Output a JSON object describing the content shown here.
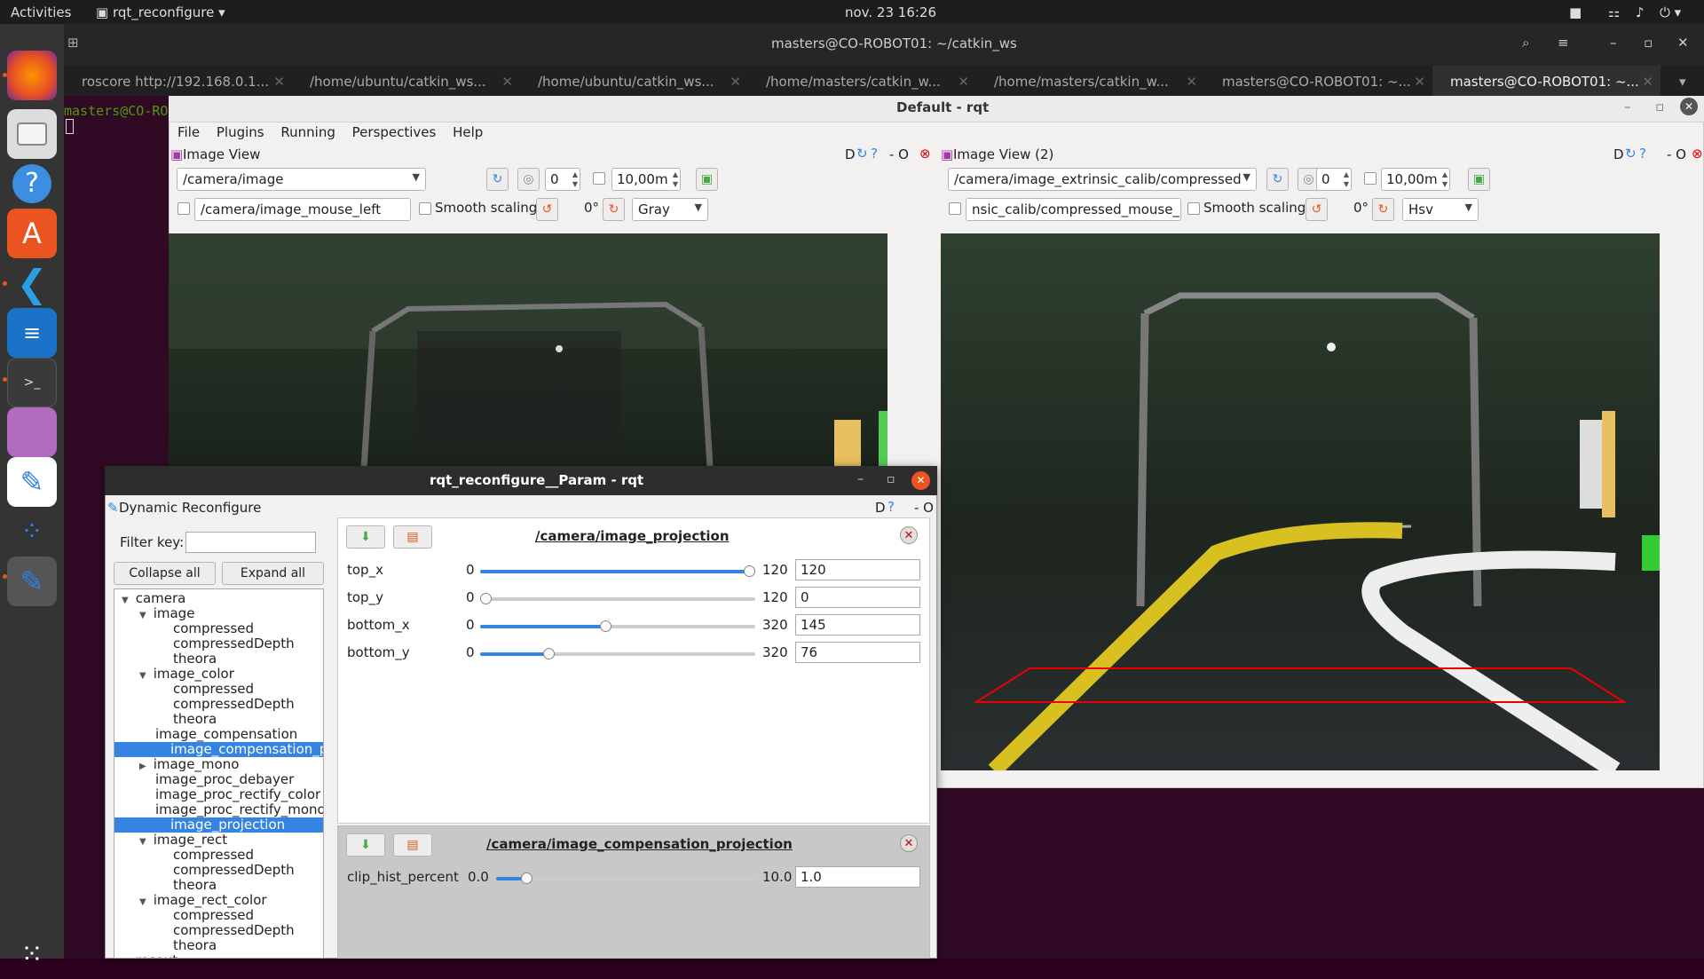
{
  "topbar": {
    "activities": "Activities",
    "app": "rqt_reconfigure",
    "datetime": "nov. 23  16:26"
  },
  "terminal": {
    "title": "masters@CO-ROBOT01: ~/catkin_ws",
    "prompt": "masters@CO-RO",
    "tabs": [
      "roscore http://192.168.0.1...",
      "/home/ubuntu/catkin_ws...",
      "/home/ubuntu/catkin_ws...",
      "/home/masters/catkin_w...",
      "/home/masters/catkin_w...",
      "masters@CO-ROBOT01: ~...",
      "masters@CO-ROBOT01: ~..."
    ]
  },
  "rqt": {
    "title": "Default - rqt",
    "menu": [
      "File",
      "Plugins",
      "Running",
      "Perspectives",
      "Help"
    ]
  },
  "iv1": {
    "title": "Image View",
    "topic": "/camera/image",
    "spin": "0",
    "rate": "10,00m",
    "mouse": "/camera/image_mouse_left",
    "smooth": "Smooth scaling",
    "rot": "0°",
    "color": "Gray",
    "tools": "D",
    "dash": "- O"
  },
  "iv2": {
    "title": "Image View (2)",
    "topic": "/camera/image_extrinsic_calib/compressed",
    "spin": "0",
    "rate": "10,00m",
    "mouse": "nsic_calib/compressed_mouse_left",
    "smooth": "Smooth scaling",
    "rot": "0°",
    "color": "Hsv",
    "tools": "D",
    "dash": "- O"
  },
  "rec": {
    "title": "rqt_reconfigure__Param - rqt",
    "plugin": "Dynamic Reconfigure",
    "filter": "Filter key:",
    "collapse": "Collapse all",
    "expand": "Expand all",
    "tools": "D",
    "dash": "- O",
    "tree": [
      {
        "t": "camera",
        "exp": "open"
      },
      {
        "t": "image",
        "exp": "open"
      },
      {
        "t": "compressed"
      },
      {
        "t": "compressedDepth"
      },
      {
        "t": "theora"
      },
      {
        "t": "image_color",
        "exp": "open"
      },
      {
        "t": "compressed"
      },
      {
        "t": "compressedDepth"
      },
      {
        "t": "theora"
      },
      {
        "t": "image_compensation"
      },
      {
        "t": "image_compensation_pro...",
        "sel": true
      },
      {
        "t": "image_mono",
        "exp": "closed"
      },
      {
        "t": "image_proc_debayer"
      },
      {
        "t": "image_proc_rectify_color"
      },
      {
        "t": "image_proc_rectify_mono"
      },
      {
        "t": "image_projection",
        "sel": true
      },
      {
        "t": "image_rect",
        "exp": "open"
      },
      {
        "t": "compressed"
      },
      {
        "t": "compressedDepth"
      },
      {
        "t": "theora"
      },
      {
        "t": "image_rect_color",
        "exp": "open"
      },
      {
        "t": "compressed"
      },
      {
        "t": "compressedDepth"
      },
      {
        "t": "theora"
      },
      {
        "t": "rosout",
        "exp": "closed"
      }
    ],
    "p1": {
      "title": "/camera/image_projection",
      "params": [
        {
          "name": "top_x",
          "min": "0",
          "max": "120",
          "val": "120"
        },
        {
          "name": "top_y",
          "min": "0",
          "max": "120",
          "val": "0"
        },
        {
          "name": "bottom_x",
          "min": "0",
          "max": "320",
          "val": "145"
        },
        {
          "name": "bottom_y",
          "min": "0",
          "max": "320",
          "val": "76"
        }
      ]
    },
    "p2": {
      "title": "/camera/image_compensation_projection",
      "params": [
        {
          "name": "clip_hist_percent",
          "min": "0.0",
          "max": "10.0",
          "val": "1.0"
        }
      ]
    }
  }
}
